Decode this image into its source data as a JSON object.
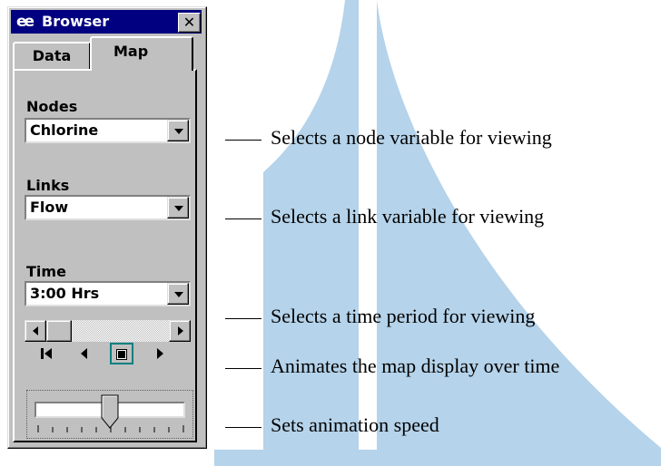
{
  "colors": {
    "background_shape": "#b5d3ea",
    "titlebar": "#000080",
    "panel": "#c0c0c0",
    "selected_button_border": "#008080"
  },
  "browser": {
    "title": "Browser",
    "title_icon": "binoculars-icon",
    "close_label": "✕",
    "tabs": [
      {
        "label": "Data",
        "active": false
      },
      {
        "label": "Map",
        "active": true
      }
    ],
    "nodes": {
      "label": "Nodes",
      "value": "Chlorine"
    },
    "links": {
      "label": "Links",
      "value": "Flow"
    },
    "time": {
      "label": "Time",
      "value": "3:00 Hrs"
    },
    "animation_buttons": [
      "rewind-icon",
      "step-back-icon",
      "stop-icon",
      "play-icon"
    ],
    "speed_slider_fraction": 0.5
  },
  "callouts": [
    "Selects a node variable for viewing",
    "Selects a link variable for viewing",
    "Selects a time period for viewing",
    "Animates the map display over time",
    "Sets animation speed"
  ]
}
